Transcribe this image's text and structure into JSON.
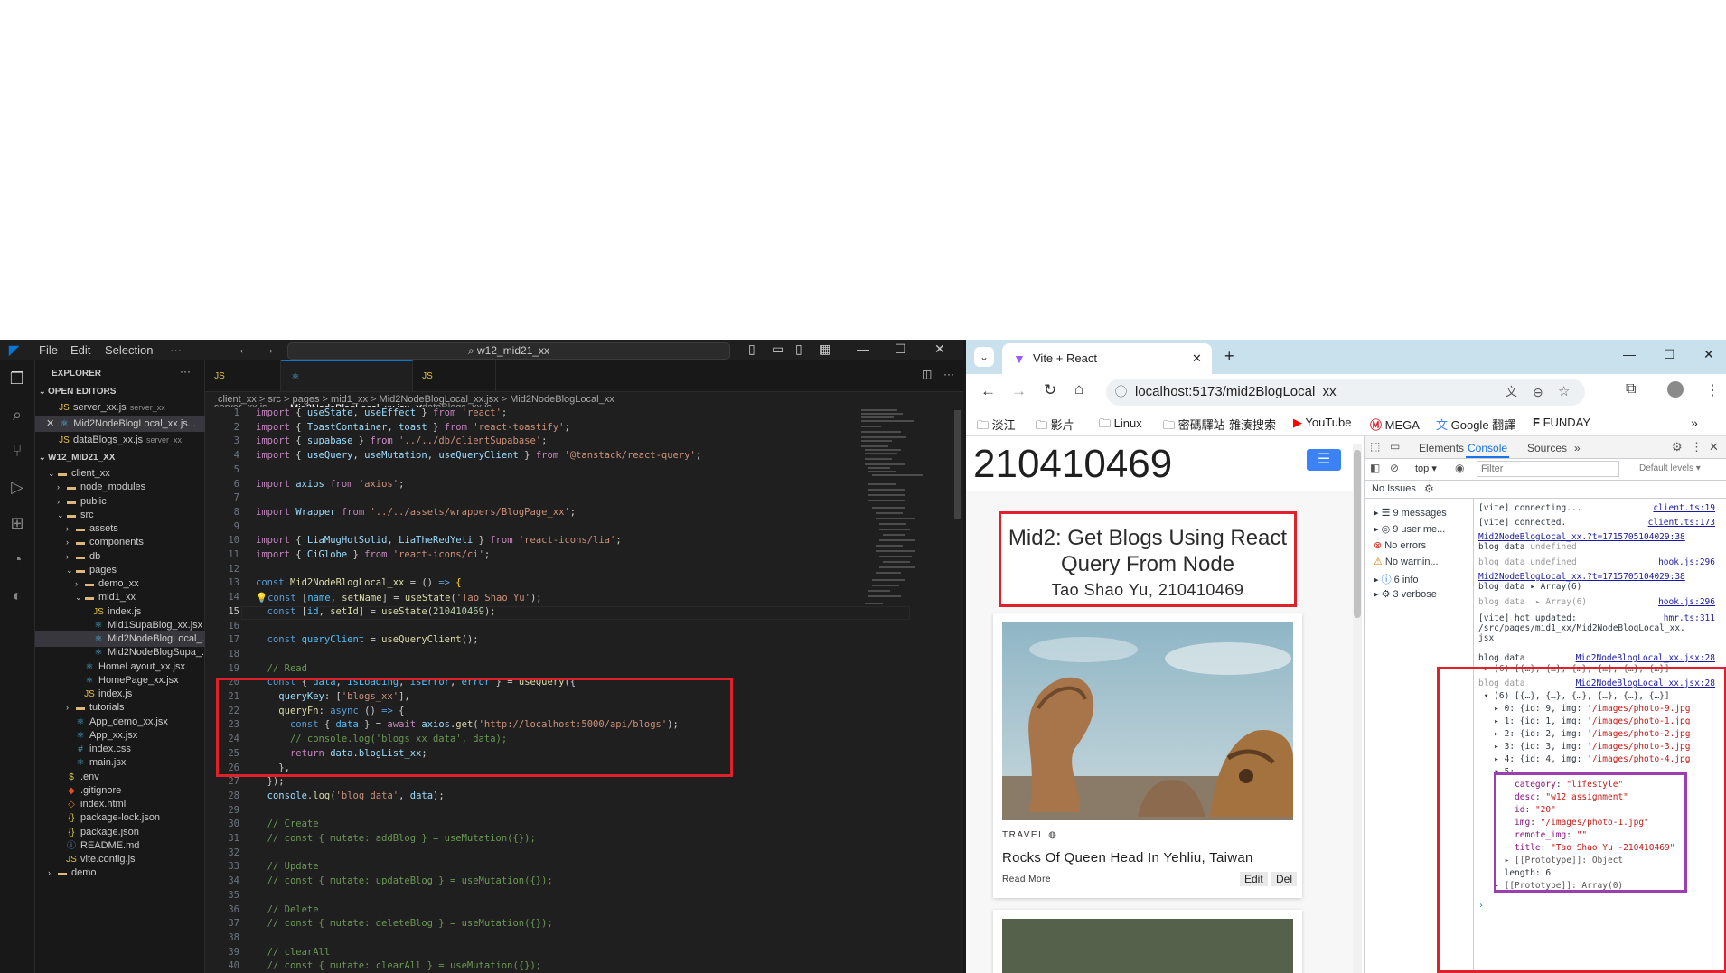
{
  "vscode": {
    "menu": [
      "File",
      "Edit",
      "Selection",
      "···"
    ],
    "search": "w12_mid21_xx",
    "explorer_title": "EXPLORER",
    "open_editors_label": "OPEN EDITORS",
    "open_editors": [
      {
        "name": "server_xx.js",
        "hint": "server_xx"
      },
      {
        "name": "Mid2NodeBlogLocal_xx.js...",
        "hint": ""
      },
      {
        "name": "dataBlogs_xx.js",
        "hint": "server_xx"
      }
    ],
    "workspace_label": "W12_MID21_XX",
    "tree": [
      {
        "label": "client_xx",
        "type": "folder",
        "depth": 1,
        "open": true
      },
      {
        "label": "node_modules",
        "type": "folder",
        "depth": 2
      },
      {
        "label": "public",
        "type": "folder",
        "depth": 2
      },
      {
        "label": "src",
        "type": "folder",
        "depth": 2,
        "open": true
      },
      {
        "label": "assets",
        "type": "folder",
        "depth": 3
      },
      {
        "label": "components",
        "type": "folder",
        "depth": 3
      },
      {
        "label": "db",
        "type": "folder",
        "depth": 3
      },
      {
        "label": "pages",
        "type": "folder",
        "depth": 3,
        "open": true
      },
      {
        "label": "demo_xx",
        "type": "folder",
        "depth": 4
      },
      {
        "label": "mid1_xx",
        "type": "folder",
        "depth": 4,
        "open": true
      },
      {
        "label": "index.js",
        "type": "js",
        "depth": 5
      },
      {
        "label": "Mid1SupaBlog_xx.jsx",
        "type": "react",
        "depth": 5
      },
      {
        "label": "Mid2NodeBlogLocal_...",
        "type": "react",
        "depth": 5,
        "selected": true
      },
      {
        "label": "Mid2NodeBlogSupa_...",
        "type": "react",
        "depth": 5
      },
      {
        "label": "HomeLayout_xx.jsx",
        "type": "react",
        "depth": 4
      },
      {
        "label": "HomePage_xx.jsx",
        "type": "react",
        "depth": 4
      },
      {
        "label": "index.js",
        "type": "js",
        "depth": 4
      },
      {
        "label": "tutorials",
        "type": "folder",
        "depth": 3
      },
      {
        "label": "App_demo_xx.jsx",
        "type": "react",
        "depth": 3
      },
      {
        "label": "App_xx.jsx",
        "type": "react",
        "depth": 3
      },
      {
        "label": "index.css",
        "type": "css",
        "depth": 3
      },
      {
        "label": "main.jsx",
        "type": "react",
        "depth": 3
      },
      {
        "label": ".env",
        "type": "env",
        "depth": 2
      },
      {
        "label": ".gitignore",
        "type": "git",
        "depth": 2
      },
      {
        "label": "index.html",
        "type": "html",
        "depth": 2
      },
      {
        "label": "package-lock.json",
        "type": "json",
        "depth": 2
      },
      {
        "label": "package.json",
        "type": "json",
        "depth": 2
      },
      {
        "label": "README.md",
        "type": "md",
        "depth": 2
      },
      {
        "label": "vite.config.js",
        "type": "js",
        "depth": 2
      },
      {
        "label": "demo",
        "type": "folder",
        "depth": 1
      }
    ],
    "tabs": [
      {
        "label": "server_xx.js"
      },
      {
        "label": "Mid2NodeBlogLocal_xx.jsx",
        "active": true
      },
      {
        "label": "dataBlogs_xx.js"
      }
    ],
    "breadcrumb": "client_xx > src > pages > mid1_xx > Mid2NodeBlogLocal_xx.jsx > Mid2NodeBlogLocal_xx",
    "line_numbers": [
      "1",
      "2",
      "3",
      "4",
      "5",
      "6",
      "7",
      "8",
      "9",
      "10",
      "11",
      "12",
      "13",
      "14",
      "15",
      "16",
      "17",
      "18",
      "19",
      "20",
      "21",
      "22",
      "23",
      "24",
      "25",
      "26",
      "27",
      "28",
      "29",
      "30",
      "31",
      "32",
      "33",
      "34",
      "35",
      "36",
      "37",
      "38",
      "39",
      "40"
    ],
    "current_line": "15"
  },
  "chrome": {
    "tab_title": "Vite + React",
    "url": "localhost:5173/mid2BlogLocal_xx",
    "bookmarks": [
      "淡江",
      "影片",
      "Linux",
      "密碼驛站-雜湊搜索",
      "YouTube",
      "MEGA",
      "Google 翻譯",
      "FUNDAY"
    ],
    "page": {
      "heading": "210410469",
      "title": "Mid2: Get Blogs Using React Query From Node",
      "author": "Tao Shao Yu, 210410469",
      "card_category": "TRAVEL",
      "card_title": "Rocks Of Queen Head In Yehliu, Taiwan",
      "read_more": "Read More",
      "edit": "Edit",
      "del": "Del"
    },
    "devtools": {
      "tabs": [
        "Elements",
        "Console",
        "Sources"
      ],
      "context": "top",
      "filter_placeholder": "Filter",
      "levels": "Default levels",
      "issues": "No Issues",
      "sidebar": [
        "9 messages",
        "9 user me...",
        "No errors",
        "No warnin...",
        "6 info",
        "3 verbose"
      ]
    }
  },
  "colors": {
    "red_box": "#e0202a",
    "purple_box": "#9b3fb0",
    "accent": "#0078d4"
  }
}
